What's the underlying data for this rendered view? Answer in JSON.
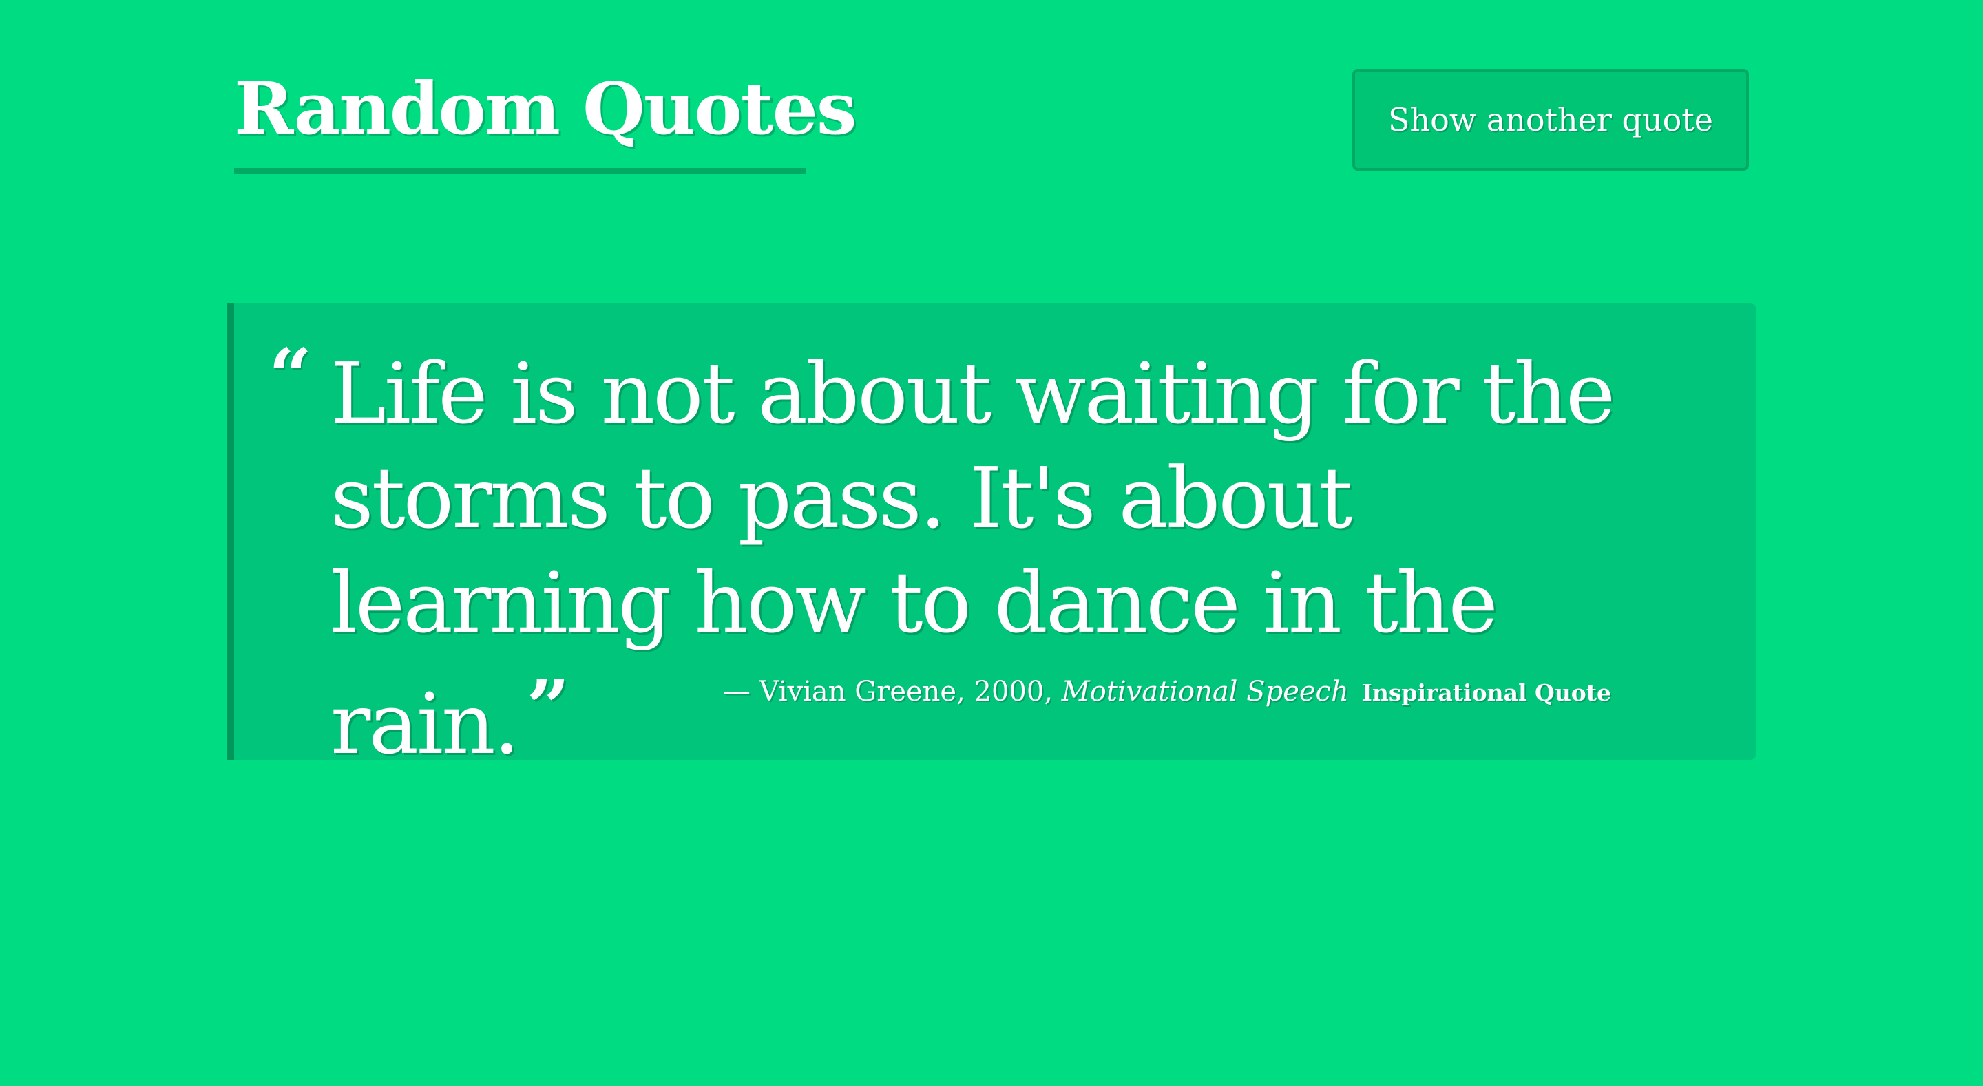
{
  "header": {
    "title": "Random Quotes",
    "new_quote_label": "Show another quote"
  },
  "quote": {
    "open_mark": "“",
    "text": "Life is not about waiting for the storms to pass. It's about learning how to dance in the rain.",
    "close_mark": "”",
    "author_prefix": "— Vivian Greene, 2000,",
    "source": "Motivational Speech",
    "category": "Inspirational Quote"
  },
  "colors": {
    "background": "#00dc82",
    "card": "#00c57a",
    "card_border": "#00975a",
    "button": "#00c574",
    "accent_dark": "#00a964",
    "text": "#ffffff"
  }
}
